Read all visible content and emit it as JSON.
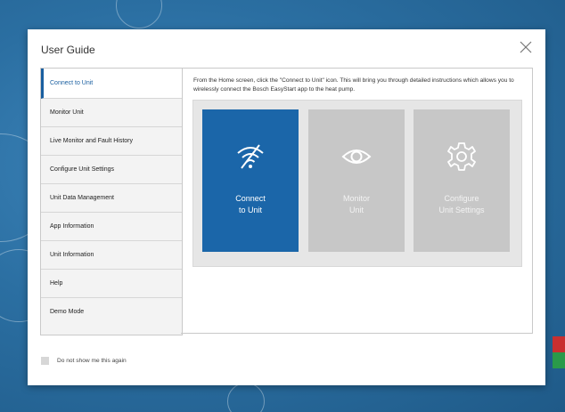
{
  "modal": {
    "title": "User Guide",
    "close_icon": "close-icon"
  },
  "sidebar": {
    "items": [
      {
        "label": "Connect to Unit",
        "active": true
      },
      {
        "label": "Monitor Unit"
      },
      {
        "label": "Live Monitor and Fault History"
      },
      {
        "label": "Configure Unit Settings"
      },
      {
        "label": "Unit Data Management"
      },
      {
        "label": "App Information"
      },
      {
        "label": "Unit Information"
      },
      {
        "label": "Help"
      },
      {
        "label": "Demo Mode"
      }
    ]
  },
  "content": {
    "description": "From the Home screen, click the \"Connect to Unit\" icon.  This will bring you through detailed instructions which allows you to wirelessly connect the Bosch EasyStart app to the heat pump.",
    "tiles": [
      {
        "line1": "Connect",
        "line2": "to Unit",
        "icon": "wifi-icon"
      },
      {
        "line1": "Monitor",
        "line2": "Unit",
        "icon": "eye-icon"
      },
      {
        "line1": "Configure",
        "line2": "Unit Settings",
        "icon": "gear-icon"
      }
    ]
  },
  "footer": {
    "checkbox_label": "Do not show me this again"
  },
  "colors": {
    "accent": "#1b66a9",
    "tile_inactive": "#c7c7c7",
    "background": "#2b6fa2"
  }
}
